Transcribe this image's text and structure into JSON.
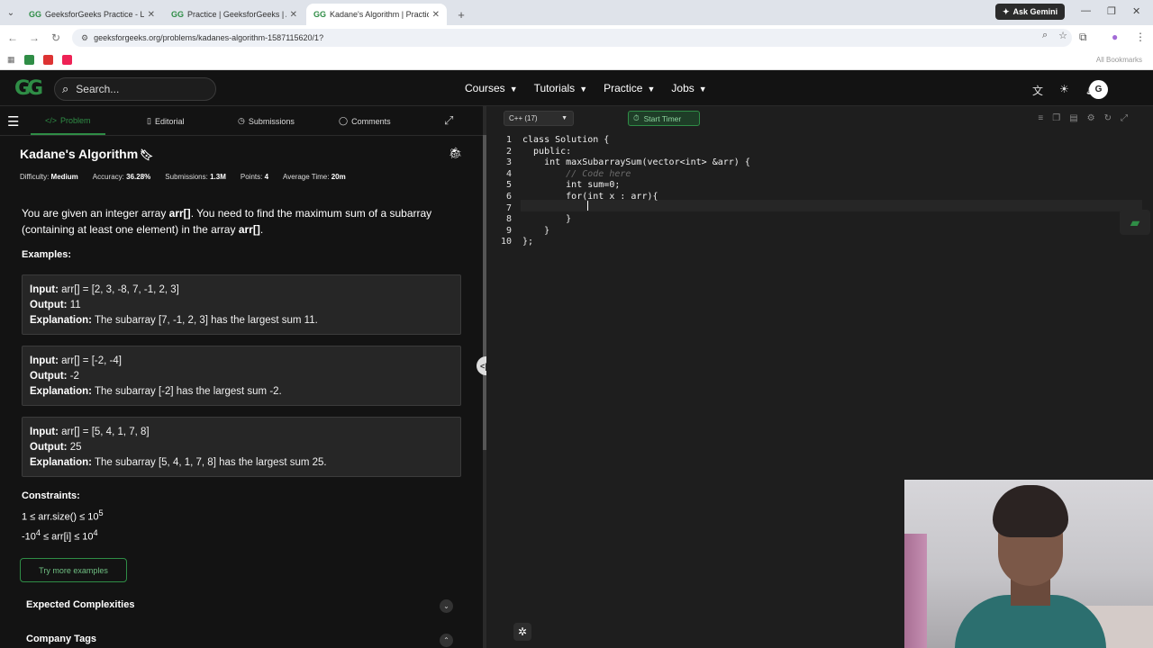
{
  "browser": {
    "tabs": [
      {
        "label": "GeeksforGeeks Practice - Leadi",
        "active": false
      },
      {
        "label": "Practice | GeeksforGeeks | A co",
        "active": false
      },
      {
        "label": "Kadane's Algorithm | Practice |",
        "active": true
      }
    ],
    "ask_gemini": "Ask Gemini",
    "url": "geeksforgeeks.org/problems/kadanes-algorithm-1587115620/1?",
    "all_bookmarks": "All Bookmarks"
  },
  "header": {
    "logo": "GG",
    "search_placeholder": "Search...",
    "nav": [
      "Courses",
      "Tutorials",
      "Practice",
      "Jobs"
    ],
    "avatar_letter": "G"
  },
  "left_tabs": [
    "Problem",
    "Editorial",
    "Submissions",
    "Comments"
  ],
  "problem": {
    "title": "Kadane's Algorithm",
    "meta": [
      {
        "label": "Difficulty:",
        "value": "Medium"
      },
      {
        "label": "Accuracy:",
        "value": "36.28%"
      },
      {
        "label": "Submissions:",
        "value": "1.3M"
      },
      {
        "label": "Points:",
        "value": "4"
      },
      {
        "label": "Average Time:",
        "value": "20m"
      }
    ],
    "desc_a": "You are given an integer array ",
    "desc_b": "arr[]",
    "desc_c": ". You need to find the maximum sum of a subarray (containing at least one element) in the array ",
    "desc_d": "arr[]",
    "desc_e": ".",
    "examples_heading": "Examples:",
    "examples": [
      {
        "input": "arr[] = [2, 3, -8, 7, -1, 2, 3]",
        "output": "11",
        "explanation": "The subarray [7, -1, 2, 3] has the largest sum 11."
      },
      {
        "input": "arr[] = [-2, -4]",
        "output": "-2",
        "explanation": "The subarray [-2] has the largest sum -2."
      },
      {
        "input": "arr[] = [5, 4, 1, 7, 8]",
        "output": "25",
        "explanation": "The subarray [5, 4, 1, 7, 8] has the largest sum 25."
      }
    ],
    "labels": {
      "input": "Input:",
      "output": "Output:",
      "explanation": "Explanation:"
    },
    "constraints_heading": "Constraints:",
    "constraint1_a": "1 ≤ arr.size() ≤ 10",
    "constraint1_sup": "5",
    "constraint2_a": "-10",
    "constraint2_sup1": "4",
    "constraint2_b": " ≤ arr[i] ≤ 10",
    "constraint2_sup2": "4",
    "try_more": "Try more examples",
    "expected_complexities": "Expected Complexities",
    "company_tags": "Company Tags"
  },
  "editor": {
    "language": "C++ (17)",
    "start_timer": "Start Timer",
    "lines": [
      {
        "n": "1",
        "code": "class Solution {"
      },
      {
        "n": "2",
        "code": "  public:"
      },
      {
        "n": "3",
        "code": "    int maxSubarraySum(vector<int> &arr) {"
      },
      {
        "n": "4",
        "code": "        // Code here"
      },
      {
        "n": "5",
        "code": "        int sum=0;"
      },
      {
        "n": "6",
        "code": "        for(int x : arr){"
      },
      {
        "n": "7",
        "code": "            "
      },
      {
        "n": "8",
        "code": "        }"
      },
      {
        "n": "9",
        "code": "    }"
      },
      {
        "n": "10",
        "code": "};"
      }
    ]
  },
  "colors": {
    "brand_green": "#2f8d46",
    "bg": "#131313",
    "editor_bg": "#1e1e1e"
  }
}
